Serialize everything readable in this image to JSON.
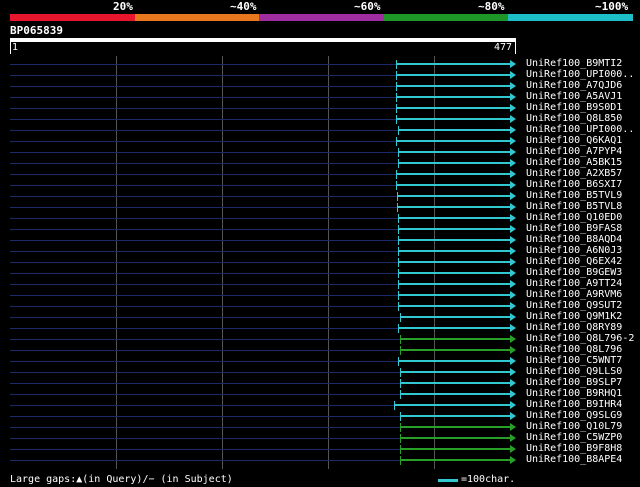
{
  "identity_bar": {
    "labels": [
      "20%",
      "~40%",
      "~60%",
      "~80%",
      "~100%"
    ],
    "colors": [
      "#e8162c",
      "#e8781e",
      "#a02da0",
      "#1e9628",
      "#1ebec8"
    ]
  },
  "query": {
    "id": "BP065839",
    "start": "1",
    "end": "477"
  },
  "colors": {
    "hit_cyan": "#32c8d2",
    "hit_green": "#28a028",
    "track": "#1c2a6a"
  },
  "hits": [
    {
      "name": "UniRef100_B9MTI2",
      "identity_class": 4,
      "start": 364,
      "end": 477
    },
    {
      "name": "UniRef100_UPI000..",
      "identity_class": 4,
      "start": 364,
      "end": 477
    },
    {
      "name": "UniRef100_A7QJD6",
      "identity_class": 4,
      "start": 364,
      "end": 477
    },
    {
      "name": "UniRef100_A5AVJ1",
      "identity_class": 4,
      "start": 364,
      "end": 477
    },
    {
      "name": "UniRef100_B9S0D1",
      "identity_class": 4,
      "start": 364,
      "end": 477
    },
    {
      "name": "UniRef100_Q8L850",
      "identity_class": 4,
      "start": 364,
      "end": 477
    },
    {
      "name": "UniRef100_UPI000..",
      "identity_class": 4,
      "start": 366,
      "end": 477
    },
    {
      "name": "UniRef100_Q6KAQ1",
      "identity_class": 4,
      "start": 364,
      "end": 477
    },
    {
      "name": "UniRef100_A7PYP4",
      "identity_class": 4,
      "start": 366,
      "end": 477
    },
    {
      "name": "UniRef100_A5BK15",
      "identity_class": 4,
      "start": 366,
      "end": 477
    },
    {
      "name": "UniRef100_A2XB57",
      "identity_class": 4,
      "start": 364,
      "end": 477
    },
    {
      "name": "UniRef100_B6SXI7",
      "identity_class": 4,
      "start": 364,
      "end": 477
    },
    {
      "name": "UniRef100_B5TVL9",
      "identity_class": 4,
      "start": 365,
      "end": 477
    },
    {
      "name": "UniRef100_B5TVL8",
      "identity_class": 4,
      "start": 365,
      "end": 477
    },
    {
      "name": "UniRef100_Q10ED0",
      "identity_class": 4,
      "start": 366,
      "end": 477
    },
    {
      "name": "UniRef100_B9FAS8",
      "identity_class": 4,
      "start": 366,
      "end": 477
    },
    {
      "name": "UniRef100_B8AQD4",
      "identity_class": 4,
      "start": 366,
      "end": 477
    },
    {
      "name": "UniRef100_A6N0J3",
      "identity_class": 4,
      "start": 366,
      "end": 477
    },
    {
      "name": "UniRef100_Q6EX42",
      "identity_class": 4,
      "start": 366,
      "end": 477
    },
    {
      "name": "UniRef100_B9GEW3",
      "identity_class": 4,
      "start": 366,
      "end": 477
    },
    {
      "name": "UniRef100_A9TT24",
      "identity_class": 4,
      "start": 366,
      "end": 477
    },
    {
      "name": "UniRef100_A9RVM6",
      "identity_class": 4,
      "start": 366,
      "end": 477
    },
    {
      "name": "UniRef100_Q9SUT2",
      "identity_class": 4,
      "start": 366,
      "end": 477
    },
    {
      "name": "UniRef100_Q9M1K2",
      "identity_class": 4,
      "start": 368,
      "end": 477
    },
    {
      "name": "UniRef100_Q8RY89",
      "identity_class": 4,
      "start": 366,
      "end": 477
    },
    {
      "name": "UniRef100_Q8L796-2",
      "identity_class": 3,
      "start": 368,
      "end": 477
    },
    {
      "name": "UniRef100_Q8L796",
      "identity_class": 3,
      "start": 368,
      "end": 477
    },
    {
      "name": "UniRef100_C5WNT7",
      "identity_class": 4,
      "start": 366,
      "end": 477
    },
    {
      "name": "UniRef100_Q9LLS0",
      "identity_class": 4,
      "start": 368,
      "end": 477
    },
    {
      "name": "UniRef100_B9SLP7",
      "identity_class": 4,
      "start": 368,
      "end": 477
    },
    {
      "name": "UniRef100_B9RHQ1",
      "identity_class": 4,
      "start": 368,
      "end": 477
    },
    {
      "name": "UniRef100_B9IHR4",
      "identity_class": 4,
      "start": 362,
      "end": 477
    },
    {
      "name": "UniRef100_Q9SLG9",
      "identity_class": 4,
      "start": 368,
      "end": 477
    },
    {
      "name": "UniRef100_Q10L79",
      "identity_class": 3,
      "start": 368,
      "end": 477
    },
    {
      "name": "UniRef100_C5WZP0",
      "identity_class": 3,
      "start": 368,
      "end": 477
    },
    {
      "name": "UniRef100_B9F8H8",
      "identity_class": 3,
      "start": 368,
      "end": 477
    },
    {
      "name": "UniRef100_B8APE4",
      "identity_class": 3,
      "start": 368,
      "end": 477
    }
  ],
  "footer": {
    "gaps_text": "Large gaps:▲(in Query)/− (in Subject)",
    "legend_text": "=100char."
  }
}
